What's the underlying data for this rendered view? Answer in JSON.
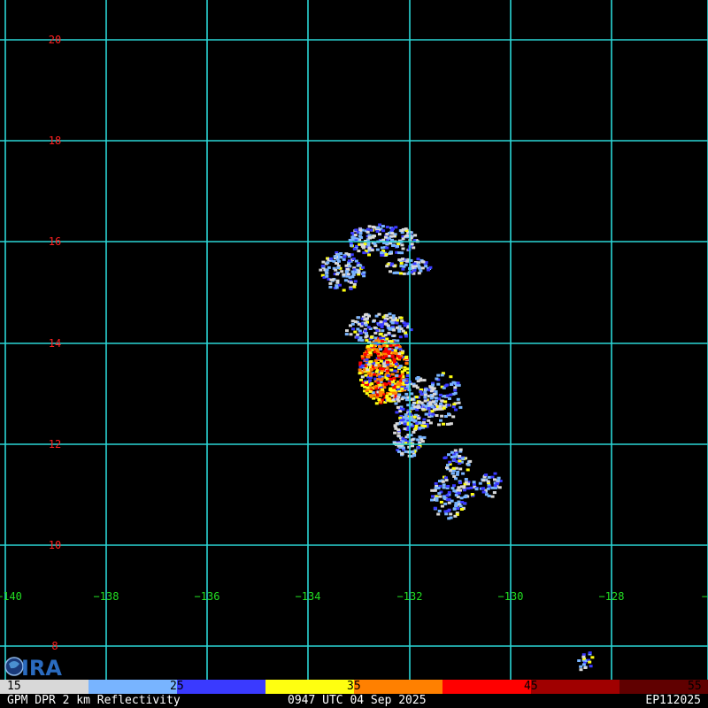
{
  "colors": {
    "background": "#000000",
    "grid": "#2ad6d6",
    "lat_label": "#ff2020",
    "lon_label": "#22dd22"
  },
  "map": {
    "latitudes": [
      "20",
      "18",
      "16",
      "14",
      "12",
      "10",
      "8"
    ],
    "longitudes": [
      "−140",
      "−138",
      "−136",
      "−134",
      "−132",
      "−130",
      "−128",
      "−"
    ]
  },
  "colorbar": {
    "segments": [
      {
        "color": "#d8d8d8"
      },
      {
        "color": "#78b4ff"
      },
      {
        "color": "#3a3aff"
      },
      {
        "color": "#ffff10"
      },
      {
        "color": "#ff8000"
      },
      {
        "color": "#ff0000"
      },
      {
        "color": "#a00000"
      },
      {
        "color": "#600000"
      }
    ],
    "labels": [
      "15",
      "25",
      "35",
      "45",
      "55"
    ]
  },
  "footer": {
    "product": "GPM DPR 2 km Reflectivity",
    "time": "0947 UTC 04 Sep 2025",
    "storm_id": "EP112025"
  },
  "logo": {
    "text": "CIRA"
  }
}
